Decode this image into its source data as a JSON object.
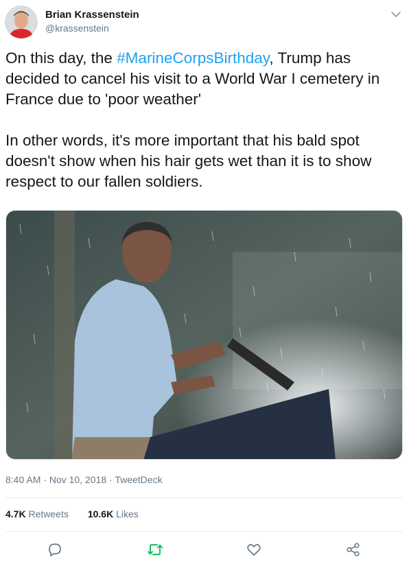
{
  "user": {
    "name": "Brian Krassenstein",
    "handle": "@krassenstein"
  },
  "tweet": {
    "text_part1": "On this day, the ",
    "hashtag": "#MarineCorpsBirthday",
    "text_part2": ", Trump has decided to cancel his visit to a World War I cemetery in France due to 'poor weather'",
    "text_paragraph2": "In other words, it's more important that his bald spot doesn't show when his hair gets wet than it is to show respect to our fallen soldiers."
  },
  "meta": {
    "time": "8:40 AM",
    "separator1": " · ",
    "date": "Nov 10, 2018",
    "separator2": " · ",
    "source": "TweetDeck"
  },
  "stats": {
    "retweets_count": "4.7K",
    "retweets_label": "Retweets",
    "likes_count": "10.6K",
    "likes_label": "Likes"
  },
  "colors": {
    "link": "#1da1f2",
    "retweet_icon": "#17bf63",
    "icon_gray": "#657786"
  },
  "icons": [
    "chevron-down-icon",
    "reply-icon",
    "retweet-icon",
    "like-icon",
    "share-icon"
  ]
}
